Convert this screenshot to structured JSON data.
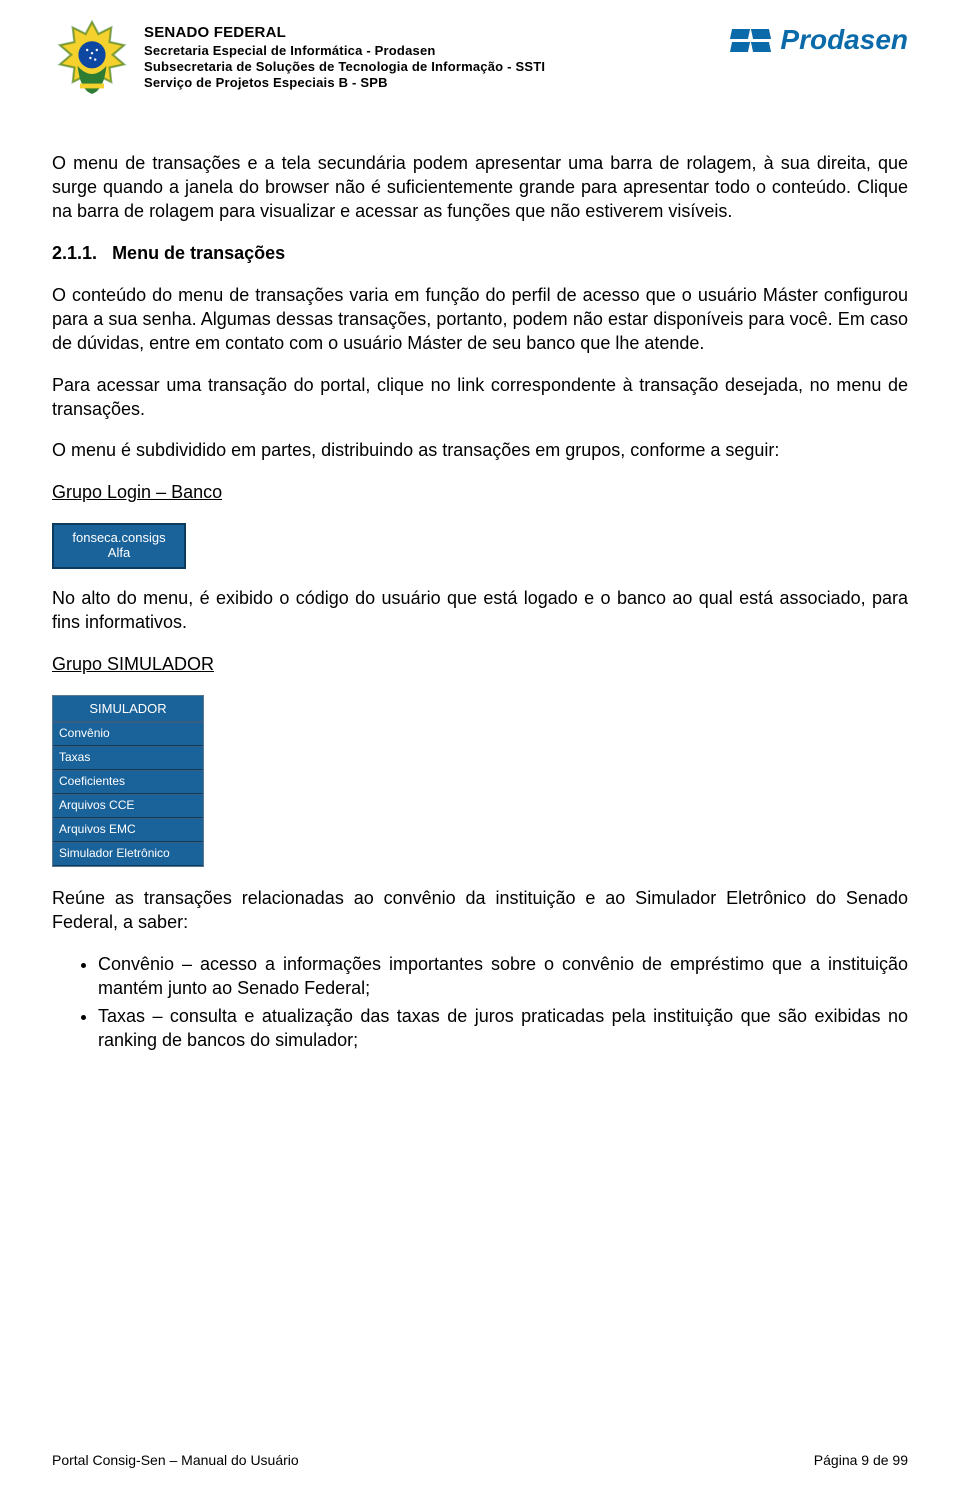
{
  "header": {
    "line0": "SENADO FEDERAL",
    "line1": "Secretaria Especial de Informática - Prodasen",
    "line2": "Subsecretaria de Soluções de Tecnologia de Informação - SSTI",
    "line3": "Serviço de Projetos Especiais B - SPB",
    "brand": "Prodasen"
  },
  "content": {
    "p1": "O menu de transações e a tela secundária podem apresentar uma barra de rolagem, à sua direita, que surge quando a janela do browser não é suficientemente grande para apresentar todo o conteúdo. Clique na barra de rolagem para visualizar e acessar as funções que não estiverem visíveis.",
    "sec_num": "2.1.1.",
    "sec_title": "Menu de transações",
    "p2": "O conteúdo do menu de transações varia em função do perfil de acesso que o usuário Máster configurou para a sua senha. Algumas dessas transações, portanto, podem não estar disponíveis para você. Em caso de dúvidas, entre em contato com o usuário Máster de seu banco que lhe atende.",
    "p3": "Para acessar uma transação do portal, clique no link correspondente à transação desejada, no menu de transações.",
    "p4": "O menu é subdividido em partes, distribuindo as transações em grupos, conforme a seguir:",
    "group_login_title": "Grupo Login – Banco",
    "login_user": "fonseca.consigs",
    "login_bank": "Alfa",
    "p5": "No alto do menu, é exibido o código do usuário que está logado e o banco ao qual está associado, para fins informativos.",
    "group_sim_title": "Grupo SIMULADOR",
    "sim_menu": {
      "header": "SIMULADOR",
      "items": [
        "Convênio",
        "Taxas",
        "Coeficientes",
        "Arquivos CCE",
        "Arquivos EMC",
        "Simulador Eletrônico"
      ]
    },
    "p6": "Reúne as transações relacionadas ao convênio da instituição e ao Simulador Eletrônico do Senado Federal, a saber:",
    "bullets": [
      "Convênio – acesso a informações importantes sobre o convênio de empréstimo que a instituição mantém junto ao Senado Federal;",
      "Taxas – consulta e atualização das taxas de juros praticadas pela instituição que são exibidas no ranking de bancos do simulador;"
    ]
  },
  "footer": {
    "left": "Portal Consig-Sen – Manual do Usuário",
    "right": "Página 9 de 99"
  }
}
